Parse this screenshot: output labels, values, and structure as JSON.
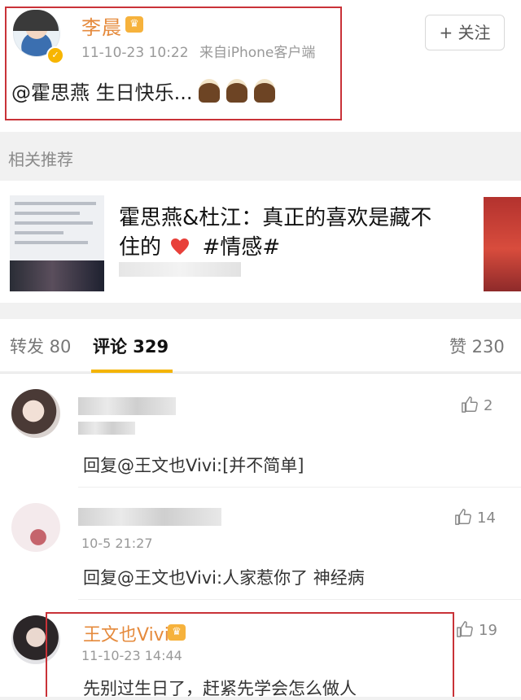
{
  "post": {
    "username": "李晨",
    "timestamp": "11-10-23 10:22",
    "source": "来自iPhone客户端",
    "text": "@霍思燕 生日快乐...",
    "follow_label": "+ 关注"
  },
  "related": {
    "label": "相关推荐",
    "title": "霍思燕&杜江：真正的喜欢是藏不住的",
    "hashtag": "#情感#"
  },
  "tabs": {
    "repost": "转发 80",
    "comments": "评论 329",
    "likes": "赞 230"
  },
  "comments": [
    {
      "text": "回复@王文也Vivi:[并不简单]",
      "likes": "2"
    },
    {
      "time": "10-5 21:27",
      "text": "回复@王文也Vivi:人家惹你了 神经病",
      "likes": "14"
    },
    {
      "username": "王文也Vivi",
      "time": "11-10-23 14:44",
      "text": "先别过生日了，赶紧先学会怎么做人",
      "likes": "19"
    }
  ],
  "colors": {
    "username": "#e58a3c",
    "highlight_box": "#c93238",
    "tab_underline": "#f4b400",
    "heart": "#e8403a"
  },
  "icons": [
    "cake-icon",
    "heart-icon",
    "thumbs-up-icon",
    "verified-icon",
    "vip-badge-icon"
  ]
}
